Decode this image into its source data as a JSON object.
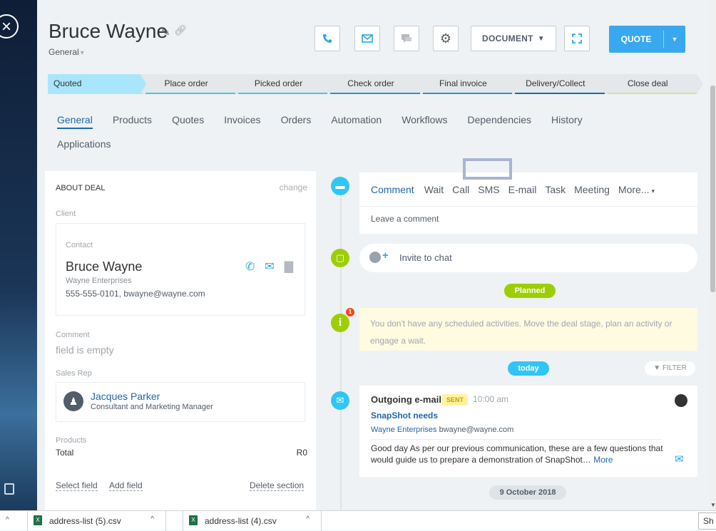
{
  "close_glyph": "×",
  "header": {
    "title": "Bruce Wayne",
    "category": "General",
    "document_label": "DOCUMENT",
    "quote_label": "QUOTE"
  },
  "stages": [
    {
      "label": "Quoted",
      "color": "#a9e6fb",
      "active": true
    },
    {
      "label": "Place order",
      "color": "#47c4ec"
    },
    {
      "label": "Picked order",
      "color": "#47c4ec"
    },
    {
      "label": "Check order",
      "color": "#2b8fd8"
    },
    {
      "label": "Final invoice",
      "color": "#2b8fd8"
    },
    {
      "label": "Delivery/Collect",
      "color": "#0d6fb8"
    },
    {
      "label": "Close deal",
      "color": "#d3e58a"
    }
  ],
  "tabs": [
    "General",
    "Products",
    "Quotes",
    "Invoices",
    "Orders",
    "Automation",
    "Workflows",
    "Dependencies",
    "History",
    "Applications"
  ],
  "about": {
    "heading": "ABOUT DEAL",
    "change": "change",
    "client_label": "Client",
    "contact_label": "Contact",
    "contact_name": "Bruce Wayne",
    "company": "Wayne Enterprises",
    "contact_info": "555-555-0101, bwayne@wayne.com",
    "comment_label": "Comment",
    "comment_value": "field is empty",
    "sales_rep_label": "Sales Rep",
    "rep_name": "Jacques Parker",
    "rep_position": "Consultant and Marketing Manager",
    "products_label": "Products",
    "total_label": "Total",
    "total_value": "R0",
    "select_field": "Select field",
    "add_field": "Add field",
    "delete_section": "Delete section"
  },
  "activity": {
    "tabs": [
      "Comment",
      "Wait",
      "Call",
      "SMS",
      "E-mail",
      "Task",
      "Meeting",
      "More..."
    ],
    "placeholder": "Leave a comment",
    "invite": "Invite to chat",
    "planned": "Planned",
    "badge_count": "1",
    "no_activity": "You don't have any scheduled activities. Move the deal stage, plan an activity or engage a wait.",
    "today": "today",
    "filter": "FILTER"
  },
  "email": {
    "title": "Outgoing e-mail",
    "status": "SENT",
    "time": "10:00 am",
    "subject": "SnapShot needs",
    "company": "Wayne Enterprises",
    "address": "bwayne@wayne.com",
    "body": "Good day  As per our previous communication, these are a few questions that would guide us to prepare a demonstration of SnapShot…",
    "more": "More"
  },
  "date_separator": "9 October 2018",
  "colors": {
    "comment_circle": "#2fc6f6",
    "chat_circle": "#9dcf00",
    "planned": "#9dcf00",
    "today": "#2fc6f6",
    "email_circle": "#2fc6f6"
  },
  "downloads": {
    "items": [
      "address-list (5).csv",
      "address-list (4).csv"
    ],
    "show_all": "Sh"
  }
}
